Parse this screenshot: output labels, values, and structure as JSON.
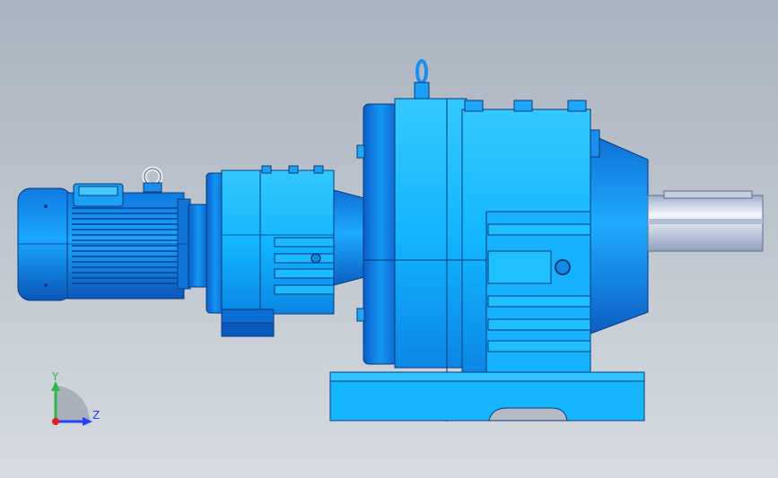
{
  "viewport": {
    "background_top": "#a9b3bf",
    "background_bottom": "#d6dbe1"
  },
  "model": {
    "body_color": "#12b6ff",
    "shadow_color": "#0a6fd0",
    "edge_color": "#0b3a7a",
    "shaft_color": "#c9d3e4"
  },
  "triad": {
    "y_label": "Y",
    "z_label": "Z",
    "y_color": "#29b84a",
    "z_color": "#2a42ff",
    "x_color": "#e02020"
  }
}
